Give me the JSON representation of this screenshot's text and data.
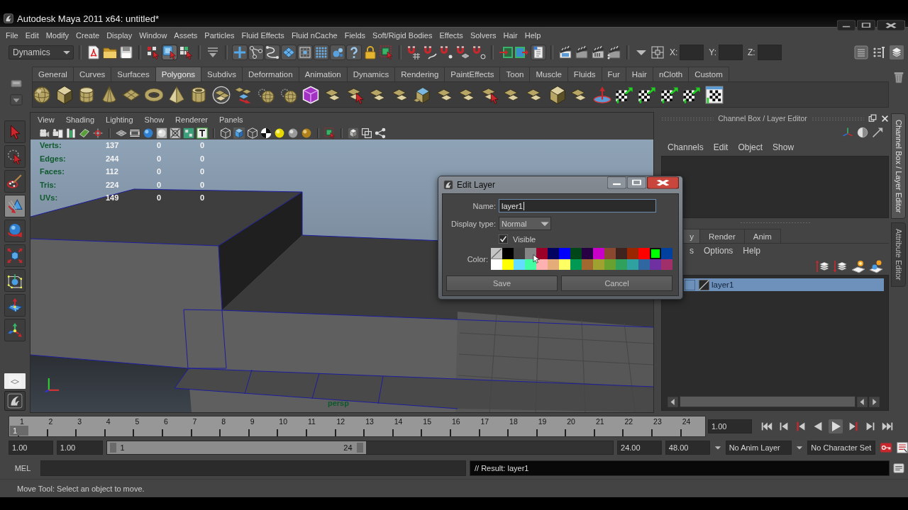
{
  "window": {
    "title": "Autodesk Maya 2011 x64: untitled*"
  },
  "menu_bar": [
    "File",
    "Edit",
    "Modify",
    "Create",
    "Display",
    "Window",
    "Assets",
    "Particles",
    "Fluid Effects",
    "Fluid nCache",
    "Fields",
    "Soft/Rigid Bodies",
    "Effects",
    "Solvers",
    "Hair",
    "Help"
  ],
  "status_line": {
    "menu_set": "Dynamics",
    "selection_modes": [
      {
        "selected": false
      },
      {
        "selected": true
      },
      {
        "selected": false
      }
    ],
    "coordinate_fields": [
      {
        "label": "X:"
      },
      {
        "label": "Y:"
      },
      {
        "label": "Z:"
      }
    ]
  },
  "shelf": {
    "tabs": [
      {
        "label": "General",
        "selected": false
      },
      {
        "label": "Curves",
        "selected": false
      },
      {
        "label": "Surfaces",
        "selected": false
      },
      {
        "label": "Polygons",
        "selected": true
      },
      {
        "label": "Subdivs",
        "selected": false
      },
      {
        "label": "Deformation",
        "selected": false
      },
      {
        "label": "Animation",
        "selected": false
      },
      {
        "label": "Dynamics",
        "selected": false
      },
      {
        "label": "Rendering",
        "selected": false
      },
      {
        "label": "PaintEffects",
        "selected": false
      },
      {
        "label": "Toon",
        "selected": false
      },
      {
        "label": "Muscle",
        "selected": false
      },
      {
        "label": "Fluids",
        "selected": false
      },
      {
        "label": "Fur",
        "selected": false
      },
      {
        "label": "Hair",
        "selected": false
      },
      {
        "label": "nCloth",
        "selected": false
      },
      {
        "label": "Custom",
        "selected": false
      }
    ]
  },
  "toolbox": [
    {
      "selected": false
    },
    {
      "selected": false
    },
    {
      "selected": false
    },
    {
      "selected": true
    },
    {
      "selected": false
    },
    {
      "selected": false
    },
    {
      "selected": false
    },
    {
      "selected": false
    },
    {
      "selected": false
    }
  ],
  "viewport": {
    "menu": [
      "View",
      "Shading",
      "Lighting",
      "Show",
      "Renderer",
      "Panels"
    ],
    "hud": [
      {
        "label": "Verts:",
        "values": [
          "137",
          "0",
          "0"
        ]
      },
      {
        "label": "Edges:",
        "values": [
          "244",
          "0",
          "0"
        ]
      },
      {
        "label": "Faces:",
        "values": [
          "112",
          "0",
          "0"
        ]
      },
      {
        "label": "Tris:",
        "values": [
          "224",
          "0",
          "0"
        ]
      },
      {
        "label": "UVs:",
        "values": [
          "149",
          "0",
          "0"
        ]
      }
    ],
    "camera": "persp"
  },
  "channel_box": {
    "title": "Channel Box / Layer Editor",
    "menu": [
      "Channels",
      "Edit",
      "Object",
      "Show"
    ]
  },
  "layer_editor": {
    "tabs": [
      {
        "label": "y",
        "selected": true
      },
      {
        "label": "Render",
        "selected": false
      },
      {
        "label": "Anim",
        "selected": false
      }
    ],
    "menu": [
      "s",
      "Options",
      "Help"
    ],
    "layers": [
      {
        "name": "layer1",
        "selected": true
      }
    ]
  },
  "side_tabs": [
    {
      "label": "Channel Box / Layer Editor",
      "selected": true
    },
    {
      "label": "Attribute Editor",
      "selected": false
    }
  ],
  "edit_layer_dialog": {
    "title": "Edit Layer",
    "name_label": "Name:",
    "name": "layer1",
    "display_type_label": "Display type:",
    "display_type": "Normal",
    "visible_label": "Visible",
    "visible": true,
    "color_label": "Color:",
    "swatches": [
      {
        "kind": "none",
        "selected": false
      },
      {
        "kind": "solid",
        "color": "#000000",
        "selected": false
      },
      {
        "kind": "solid",
        "color": "#404040",
        "selected": false
      },
      {
        "kind": "solid",
        "color": "#858585",
        "selected": false
      },
      {
        "kind": "solid",
        "color": "#9b0028",
        "selected": false
      },
      {
        "kind": "solid",
        "color": "#000460",
        "selected": false
      },
      {
        "kind": "solid",
        "color": "#0000ff",
        "selected": false
      },
      {
        "kind": "solid",
        "color": "#004619",
        "selected": false
      },
      {
        "kind": "solid",
        "color": "#260043",
        "selected": false
      },
      {
        "kind": "solid",
        "color": "#c800c8",
        "selected": false
      },
      {
        "kind": "solid",
        "color": "#8a4830",
        "selected": false
      },
      {
        "kind": "solid",
        "color": "#3f231f",
        "selected": false
      },
      {
        "kind": "solid",
        "color": "#992600",
        "selected": false
      },
      {
        "kind": "solid",
        "color": "#ff0000",
        "selected": false
      },
      {
        "kind": "solid",
        "color": "#00ff00",
        "selected": true
      },
      {
        "kind": "solid",
        "color": "#0041a0",
        "selected": false
      },
      {
        "kind": "solid",
        "color": "#ffffff",
        "selected": false
      },
      {
        "kind": "solid",
        "color": "#ffff00",
        "selected": false
      },
      {
        "kind": "solid",
        "color": "#64dcff",
        "selected": false
      },
      {
        "kind": "solid",
        "color": "#43ffa3",
        "selected": false
      },
      {
        "kind": "solid",
        "color": "#ffb0b0",
        "selected": false
      },
      {
        "kind": "solid",
        "color": "#e4ac79",
        "selected": false
      },
      {
        "kind": "solid",
        "color": "#ffff63",
        "selected": false
      },
      {
        "kind": "solid",
        "color": "#009954",
        "selected": false
      },
      {
        "kind": "solid",
        "color": "#a16930",
        "selected": false
      },
      {
        "kind": "solid",
        "color": "#9fa130",
        "selected": false
      },
      {
        "kind": "solid",
        "color": "#68a130",
        "selected": false
      },
      {
        "kind": "solid",
        "color": "#30a15d",
        "selected": false
      },
      {
        "kind": "solid",
        "color": "#30a1a1",
        "selected": false
      },
      {
        "kind": "solid",
        "color": "#3067a1",
        "selected": false
      },
      {
        "kind": "solid",
        "color": "#6f30a1",
        "selected": false
      },
      {
        "kind": "solid",
        "color": "#a1306a",
        "selected": false
      }
    ],
    "buttons": [
      "Save",
      "Cancel"
    ]
  },
  "time_slider": {
    "ticks": [
      "1",
      "2",
      "3",
      "4",
      "5",
      "6",
      "7",
      "8",
      "9",
      "10",
      "11",
      "12",
      "13",
      "14",
      "15",
      "16",
      "17",
      "18",
      "19",
      "20",
      "21",
      "22",
      "23",
      "24"
    ],
    "current_frame": "1",
    "level": 0,
    "current_time": "1.00"
  },
  "range_slider": {
    "start_time": "1.00",
    "playback_start": "1.00",
    "range_start": "1",
    "range_end": "24",
    "playback_end": "24.00",
    "end_time": "48.00",
    "anim_layer": "No Anim Layer",
    "character_set": "No Character Set"
  },
  "command_line": {
    "language": "MEL",
    "result": "// Result: layer1"
  },
  "help_line": "Move Tool: Select an object to move."
}
